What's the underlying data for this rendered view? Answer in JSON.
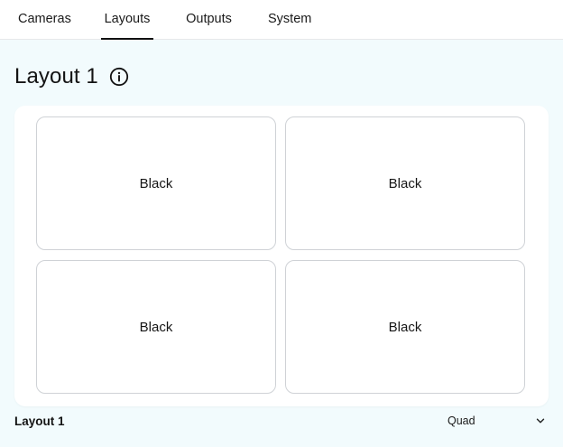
{
  "nav": {
    "tabs": [
      {
        "label": "Cameras"
      },
      {
        "label": "Layouts",
        "active": true
      },
      {
        "label": "Outputs"
      },
      {
        "label": "System"
      }
    ]
  },
  "page": {
    "title": "Layout 1",
    "info_icon": "info-icon"
  },
  "grid": {
    "cells": [
      {
        "label": "Black"
      },
      {
        "label": "Black"
      },
      {
        "label": "Black"
      },
      {
        "label": "Black"
      }
    ]
  },
  "footer": {
    "layout_name": "Layout 1",
    "layout_type": {
      "value": "Quad",
      "icon": "chevron-down-icon"
    }
  },
  "colors": {
    "background": "#f2fbfd",
    "card": "#ffffff",
    "active_tab_underline": "#111111"
  }
}
